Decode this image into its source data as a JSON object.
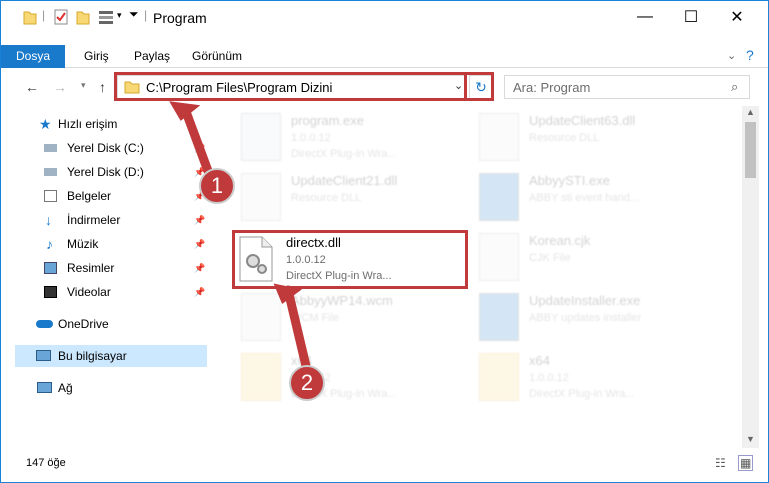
{
  "window": {
    "title": "Program"
  },
  "ribbon": {
    "tabs": [
      "Dosya",
      "Giriş",
      "Paylaş",
      "Görünüm"
    ]
  },
  "address": {
    "path": "C:\\Program Files\\Program Dizini",
    "search_placeholder": "Ara: Program"
  },
  "nav": {
    "quick_access": "Hızlı erişim",
    "items": [
      "Yerel Disk (C:)",
      "Yerel Disk (D:)",
      "Belgeler",
      "İndirmeler",
      "Müzik",
      "Resimler",
      "Videolar"
    ],
    "onedrive": "OneDrive",
    "this_pc": "Bu bilgisayar",
    "network": "Ağ"
  },
  "files": [
    {
      "name": "program.exe",
      "l2": "1.0.0.12",
      "l3": "DirectX Plug-in Wra..."
    },
    {
      "name": "UpdateClient63.dll",
      "l2": "Resource DLL",
      "l3": ""
    },
    {
      "name": "UpdateClient21.dll",
      "l2": "Resource DLL",
      "l3": ""
    },
    {
      "name": "AbbyySTI.exe",
      "l2": "ABBY sti event hand...",
      "l3": ""
    },
    {
      "name": "directx.dll",
      "l2": "1.0.0.12",
      "l3": "DirectX Plug-in Wra..."
    },
    {
      "name": "Korean.cjk",
      "l2": "CJK File",
      "l3": ""
    },
    {
      "name": "AbbyyWP14.wcm",
      "l2": "WCM File",
      "l3": ""
    },
    {
      "name": "UpdateInstaller.exe",
      "l2": "ABBY updates installer",
      "l3": ""
    },
    {
      "name": "x64",
      "l2": "1.0.0.12",
      "l3": "DirectX Plug-in Wra..."
    },
    {
      "name": "x64",
      "l2": "1.0.0.12",
      "l3": "DirectX Plug-in Wra..."
    }
  ],
  "status": {
    "count": "147 öğe"
  },
  "callouts": [
    "1",
    "2"
  ],
  "colors": {
    "accent": "#1979ca",
    "highlight": "#c0393b"
  }
}
